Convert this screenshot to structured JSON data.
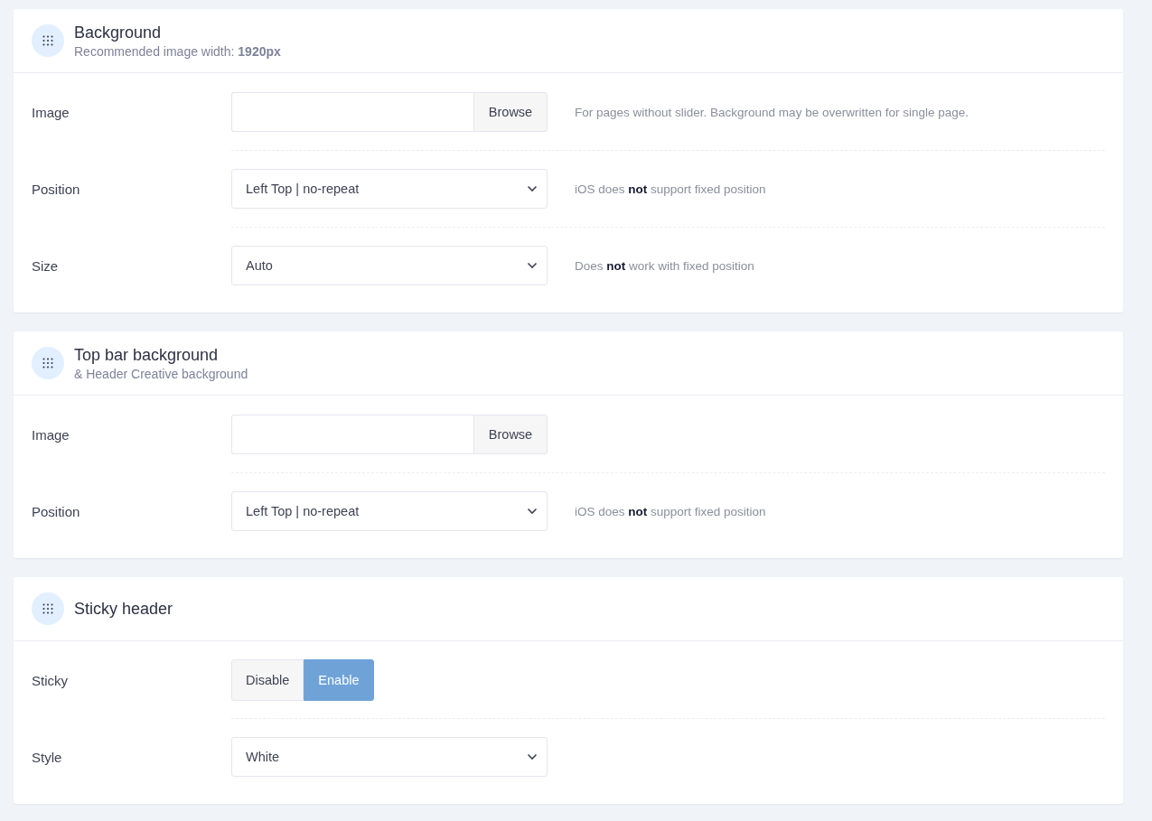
{
  "sections": [
    {
      "title": "Background",
      "subtitle": "Recommended image width: **1920px**",
      "fields": [
        {
          "kind": "file",
          "label": "Image",
          "button": "Browse",
          "hint": "For pages without slider. Background may be overwritten for single page."
        },
        {
          "kind": "select",
          "label": "Position",
          "value": "Left Top | no-repeat",
          "hint": "iOS does **not** support fixed position"
        },
        {
          "kind": "select",
          "label": "Size",
          "value": "Auto",
          "hint": "Does **not** work with fixed position"
        }
      ]
    },
    {
      "title": "Top bar background",
      "subtitle": "& Header Creative background",
      "fields": [
        {
          "kind": "file",
          "label": "Image",
          "button": "Browse"
        },
        {
          "kind": "select",
          "label": "Position",
          "value": "Left Top | no-repeat",
          "hint": "iOS does **not** support fixed position"
        }
      ]
    },
    {
      "title": "Sticky header",
      "fields": [
        {
          "kind": "toggle",
          "label": "Sticky",
          "options": [
            {
              "label": "Disable",
              "selected": false
            },
            {
              "label": "Enable",
              "selected": true
            }
          ]
        },
        {
          "kind": "select",
          "label": "Style",
          "value": "White"
        }
      ]
    }
  ]
}
